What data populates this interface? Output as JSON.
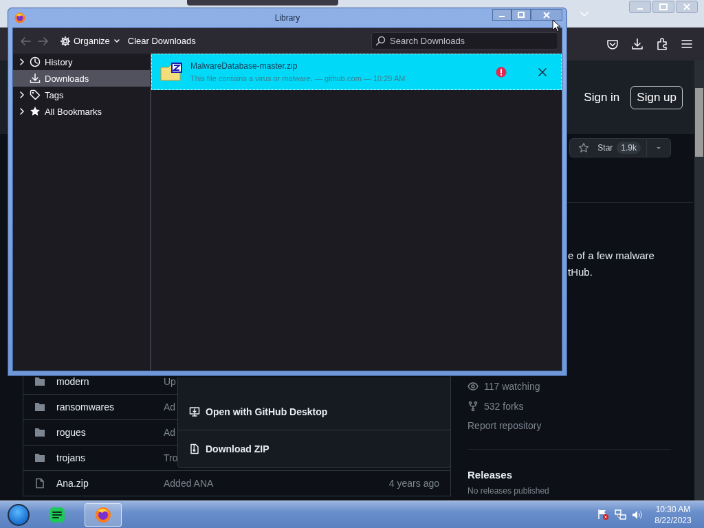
{
  "library": {
    "title": "Library",
    "toolbar": {
      "organize": "Organize",
      "clear": "Clear Downloads",
      "search": {
        "placeholder": "Search Downloads"
      }
    },
    "sidebar": [
      {
        "kind": "history",
        "label": "History",
        "expandable": true,
        "selected": false
      },
      {
        "kind": "downloads",
        "label": "Downloads",
        "expandable": false,
        "selected": true
      },
      {
        "kind": "tags",
        "label": "Tags",
        "expandable": true,
        "selected": false
      },
      {
        "kind": "bookmarks",
        "label": "All Bookmarks",
        "expandable": true,
        "selected": false
      }
    ],
    "downloads": [
      {
        "name": "MalwareDatabase-master.zip",
        "status": "This file contains a virus or malware. — github.com — 10:29 AM",
        "blocked": true,
        "selected": true
      }
    ]
  },
  "page": {
    "header": {
      "sign_in": "Sign in",
      "sign_up": "Sign up"
    },
    "star": {
      "label": "Star",
      "count": "1.9k"
    },
    "about_fragment": [
      "e of a few malware",
      "tHub."
    ],
    "files": [
      {
        "kind": "folder",
        "name": "modern",
        "message": "Up"
      },
      {
        "kind": "folder",
        "name": "ransomwares",
        "message": "Ad"
      },
      {
        "kind": "folder",
        "name": "rogues",
        "message": "Ad"
      },
      {
        "kind": "folder",
        "name": "trojans",
        "message": "Tro"
      },
      {
        "kind": "file",
        "name": "Ana.zip",
        "message": "Added ANA",
        "time": "4 years ago"
      }
    ],
    "code_menu": [
      {
        "kind": "desktop",
        "label": "Open with GitHub Desktop"
      },
      {
        "kind": "zip",
        "label": "Download ZIP"
      }
    ],
    "stats": [
      {
        "kind": "watching",
        "text": "117 watching"
      },
      {
        "kind": "forks",
        "text": "532 forks"
      }
    ],
    "report": "Report repository",
    "releases": {
      "title": "Releases",
      "note": "No releases published"
    }
  },
  "taskbar": {
    "apps": [
      {
        "kind": "notes",
        "selected": false
      },
      {
        "kind": "browser",
        "selected": true
      }
    ],
    "clock": {
      "time": "10:30 AM",
      "date": "8/22/2023"
    }
  }
}
